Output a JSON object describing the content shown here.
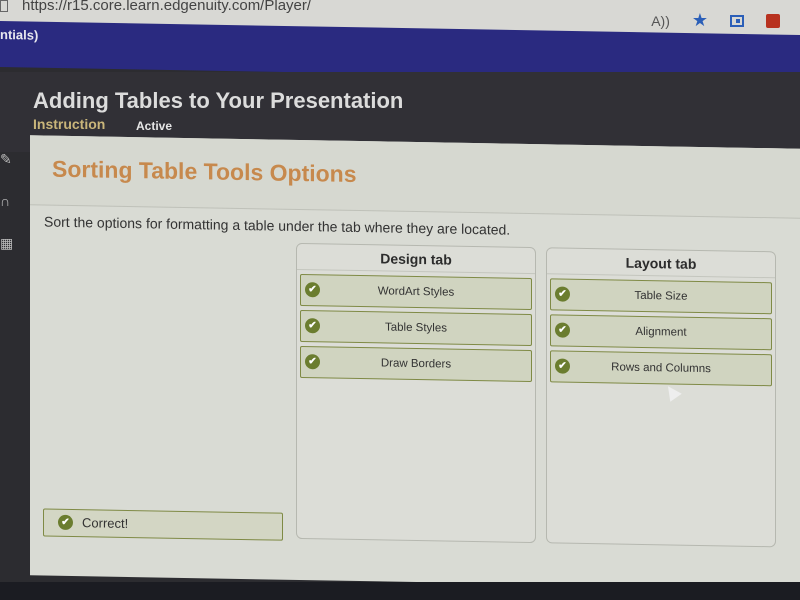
{
  "browser": {
    "url": "https://r15.core.learn.edgenuity.com/Player/",
    "icons": [
      "read-aloud-icon",
      "favorite-star-icon",
      "collections-icon",
      "extension-icon"
    ]
  },
  "course_bar": {
    "crumb": "ntials)"
  },
  "lesson": {
    "title": "Adding Tables to Your Presentation",
    "section": "Instruction",
    "status": "Active"
  },
  "sidebar": {
    "icons": [
      "pencil-icon",
      "headphones-icon",
      "calculator-icon"
    ]
  },
  "activity": {
    "heading": "Sorting Table Tools Options",
    "instruction": "Sort the options for formatting a table under the tab where they are located.",
    "buckets": [
      {
        "title": "Design tab",
        "items": [
          "WordArt Styles",
          "Table Styles",
          "Draw Borders"
        ]
      },
      {
        "title": "Layout tab",
        "items": [
          "Table Size",
          "Alignment",
          "Rows and Columns"
        ]
      }
    ],
    "feedback": "Correct!",
    "check_glyph": "✔"
  }
}
